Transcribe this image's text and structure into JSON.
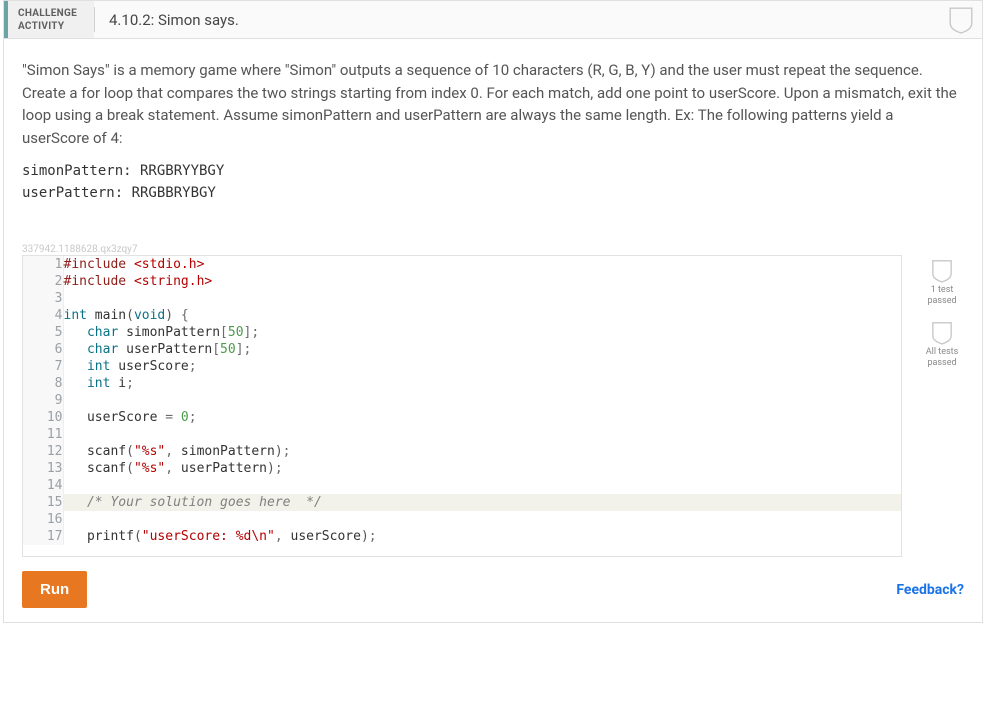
{
  "header": {
    "challenge_tag_line1": "CHALLENGE",
    "challenge_tag_line2": "ACTIVITY",
    "title": "4.10.2: Simon says."
  },
  "description": "\"Simon Says\" is a memory game where \"Simon\" outputs a sequence of 10 characters (R, G, B, Y) and the user must repeat the sequence. Create a for loop that compares the two strings starting from index 0. For each match, add one point to userScore. Upon a mismatch, exit the loop using a break statement. Assume simonPattern and userPattern are always the same length. Ex: The following patterns yield a userScore of 4:",
  "patterns": {
    "line1": "simonPattern: RRGBRYYBGY",
    "line2": "userPattern:  RRGBBRYBGY"
  },
  "hash_id": "337942.1188628.qx3zqy7",
  "code": {
    "lines": [
      {
        "n": 1,
        "tokens": [
          {
            "t": "#include ",
            "c": "kw-prep"
          },
          {
            "t": "<stdio.h>",
            "c": "str"
          }
        ]
      },
      {
        "n": 2,
        "tokens": [
          {
            "t": "#include ",
            "c": "kw-prep"
          },
          {
            "t": "<string.h>",
            "c": "str"
          }
        ]
      },
      {
        "n": 3,
        "tokens": []
      },
      {
        "n": 4,
        "tokens": [
          {
            "t": "int",
            "c": "type"
          },
          {
            "t": " main",
            "c": "ident"
          },
          {
            "t": "(",
            "c": "paren"
          },
          {
            "t": "void",
            "c": "type"
          },
          {
            "t": ")",
            "c": "paren"
          },
          {
            "t": " {",
            "c": "punc"
          }
        ]
      },
      {
        "n": 5,
        "tokens": [
          {
            "t": "   ",
            "c": ""
          },
          {
            "t": "char",
            "c": "type"
          },
          {
            "t": " simonPattern",
            "c": "ident"
          },
          {
            "t": "[",
            "c": "punc"
          },
          {
            "t": "50",
            "c": "num"
          },
          {
            "t": "]",
            "c": "punc"
          },
          {
            "t": ";",
            "c": "punc"
          }
        ]
      },
      {
        "n": 6,
        "tokens": [
          {
            "t": "   ",
            "c": ""
          },
          {
            "t": "char",
            "c": "type"
          },
          {
            "t": " userPattern",
            "c": "ident"
          },
          {
            "t": "[",
            "c": "punc"
          },
          {
            "t": "50",
            "c": "num"
          },
          {
            "t": "]",
            "c": "punc"
          },
          {
            "t": ";",
            "c": "punc"
          }
        ]
      },
      {
        "n": 7,
        "tokens": [
          {
            "t": "   ",
            "c": ""
          },
          {
            "t": "int",
            "c": "type"
          },
          {
            "t": " userScore",
            "c": "ident"
          },
          {
            "t": ";",
            "c": "punc"
          }
        ]
      },
      {
        "n": 8,
        "tokens": [
          {
            "t": "   ",
            "c": ""
          },
          {
            "t": "int",
            "c": "type"
          },
          {
            "t": " i",
            "c": "ident"
          },
          {
            "t": ";",
            "c": "punc"
          }
        ]
      },
      {
        "n": 9,
        "tokens": []
      },
      {
        "n": 10,
        "tokens": [
          {
            "t": "   userScore ",
            "c": "ident"
          },
          {
            "t": "=",
            "c": "punc"
          },
          {
            "t": " ",
            "c": ""
          },
          {
            "t": "0",
            "c": "num"
          },
          {
            "t": ";",
            "c": "punc"
          }
        ]
      },
      {
        "n": 11,
        "tokens": []
      },
      {
        "n": 12,
        "tokens": [
          {
            "t": "   scanf",
            "c": "func"
          },
          {
            "t": "(",
            "c": "paren"
          },
          {
            "t": "\"%s\"",
            "c": "str"
          },
          {
            "t": ",",
            "c": "punc"
          },
          {
            "t": " simonPattern",
            "c": "ident"
          },
          {
            "t": ")",
            "c": "paren"
          },
          {
            "t": ";",
            "c": "punc"
          }
        ]
      },
      {
        "n": 13,
        "tokens": [
          {
            "t": "   scanf",
            "c": "func"
          },
          {
            "t": "(",
            "c": "paren"
          },
          {
            "t": "\"%s\"",
            "c": "str"
          },
          {
            "t": ",",
            "c": "punc"
          },
          {
            "t": " userPattern",
            "c": "ident"
          },
          {
            "t": ")",
            "c": "paren"
          },
          {
            "t": ";",
            "c": "punc"
          }
        ]
      },
      {
        "n": 14,
        "tokens": []
      },
      {
        "n": 15,
        "hl": true,
        "tokens": [
          {
            "t": "   ",
            "c": ""
          },
          {
            "t": "/* Your solution goes here  */",
            "c": "comment"
          }
        ]
      },
      {
        "n": 16,
        "tokens": []
      },
      {
        "n": 17,
        "tokens": [
          {
            "t": "   printf",
            "c": "func"
          },
          {
            "t": "(",
            "c": "paren"
          },
          {
            "t": "\"userScore: %d\\n\"",
            "c": "str"
          },
          {
            "t": ",",
            "c": "punc"
          },
          {
            "t": " userScore",
            "c": "ident"
          },
          {
            "t": ")",
            "c": "paren"
          },
          {
            "t": ";",
            "c": "punc"
          }
        ]
      }
    ]
  },
  "badges": {
    "one_test": "1 test passed",
    "all_tests": "All tests passed"
  },
  "footer": {
    "run": "Run",
    "feedback": "Feedback?"
  }
}
